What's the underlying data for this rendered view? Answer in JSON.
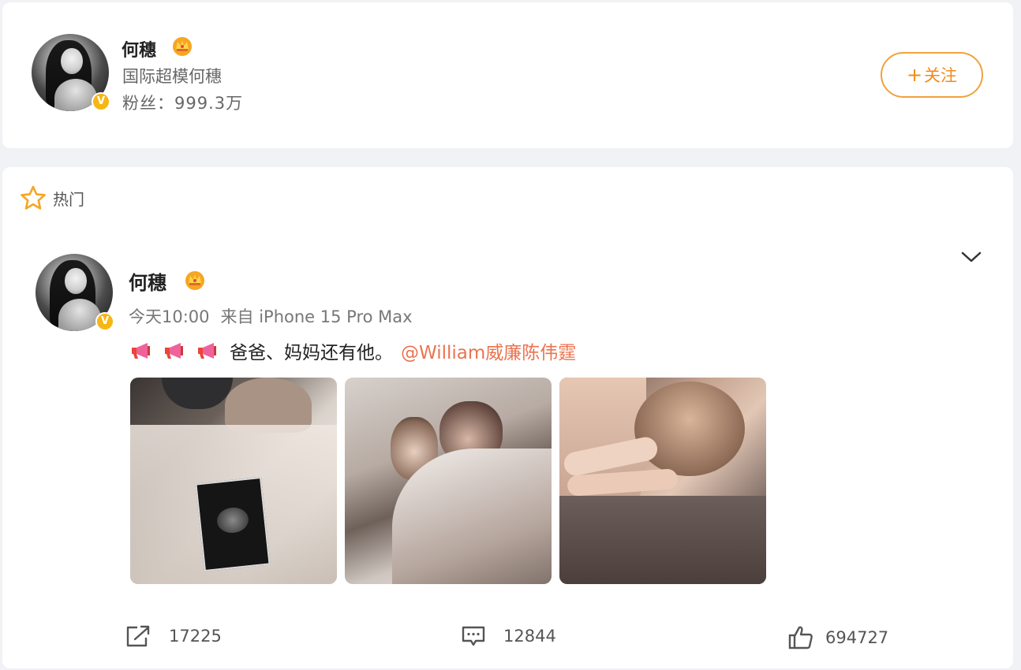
{
  "profile": {
    "name": "何穗",
    "description": "国际超模何穗",
    "fans_label": "粉丝：",
    "fans_count": "999.3万",
    "follow_button": "关注",
    "follow_plus": "+"
  },
  "feed": {
    "section_label": "热门",
    "post": {
      "author": "何穗",
      "time": "今天10:00",
      "source": "来自 iPhone 15 Pro Max",
      "text": "爸爸、妈妈还有他。",
      "mention": "@William威廉陈伟霆",
      "megaphone_count": 3,
      "photos": [
        "photo-couple-ultrasound",
        "photo-family-selfie",
        "photo-mother-baby"
      ],
      "actions": {
        "reposts": "17225",
        "comments": "12844",
        "likes": "694727"
      }
    }
  },
  "colors": {
    "accent": "#f08a1d",
    "mention": "#eb7350",
    "verified": "#f6b715",
    "background": "#f1f2f5"
  },
  "icons": {
    "verified": "verified-v-icon",
    "crown": "crown-icon",
    "hot": "star-icon",
    "more": "chevron-down-icon",
    "repost": "share-icon",
    "comment": "comment-icon",
    "like": "thumbs-up-icon",
    "megaphone": "megaphone-icon"
  }
}
